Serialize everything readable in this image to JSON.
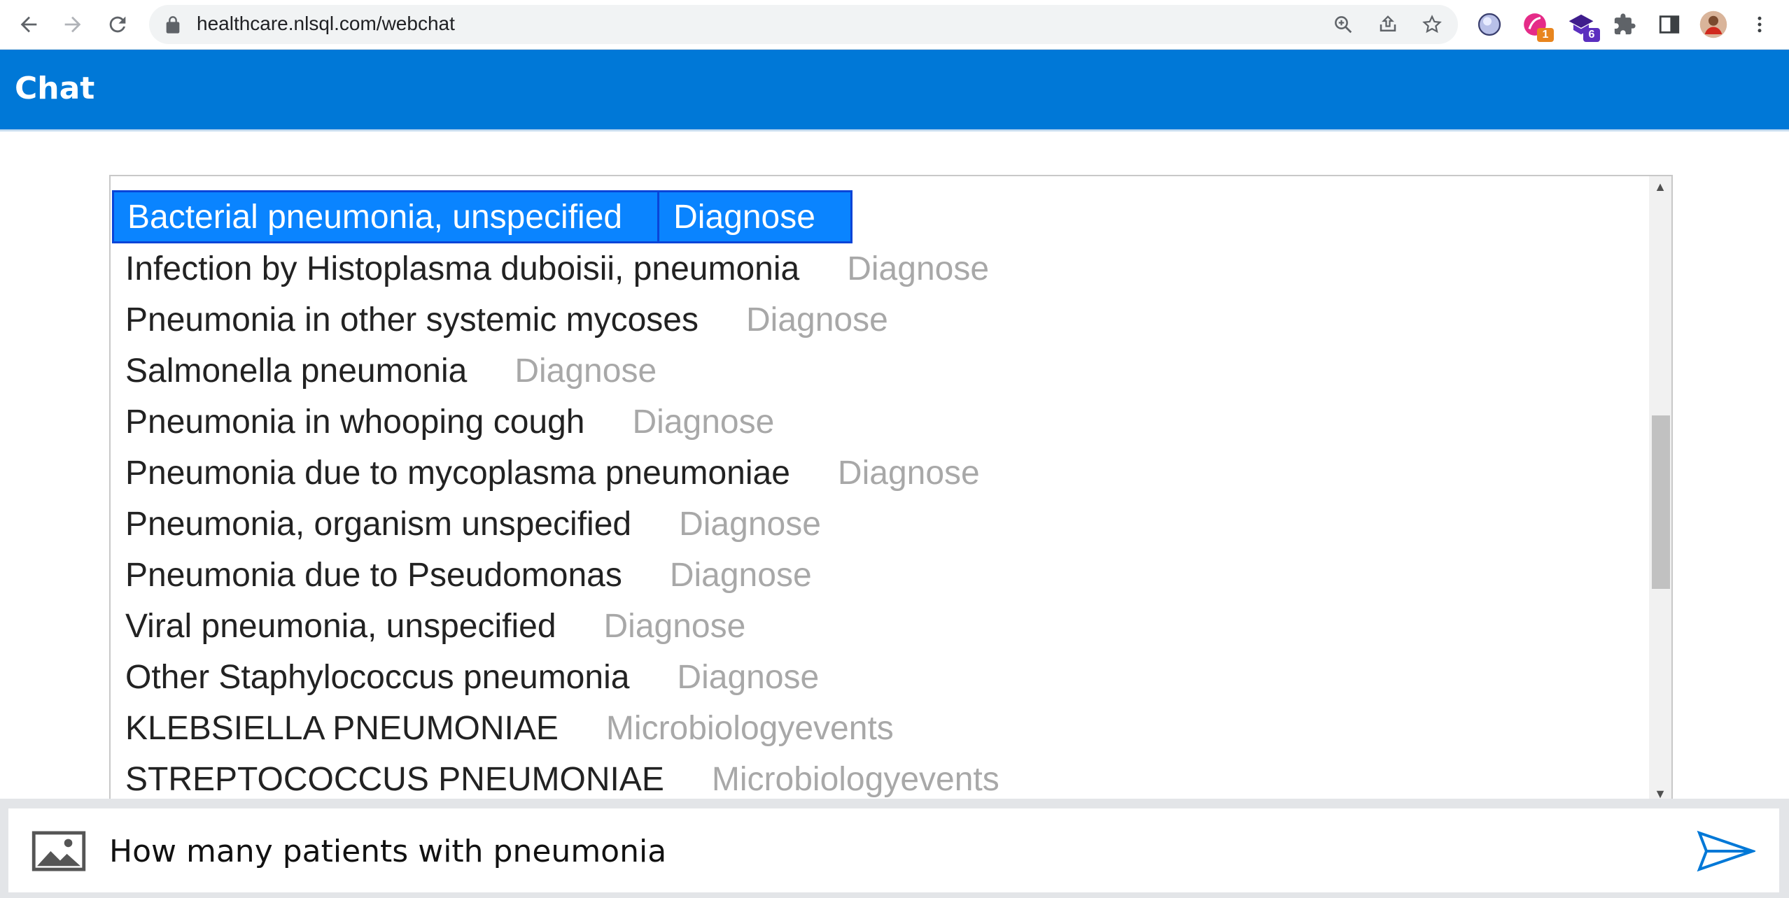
{
  "browser": {
    "url": "healthcare.nlsql.com/webchat",
    "extensions": [
      {
        "name": "circle-extension-icon",
        "badge": ""
      },
      {
        "name": "pen-extension-icon",
        "badge": "1"
      },
      {
        "name": "cap-extension-icon",
        "badge": "6"
      },
      {
        "name": "puzzle-icon",
        "badge": ""
      }
    ]
  },
  "header": {
    "title": "Chat"
  },
  "results": {
    "partial_row_name": "Ba...",
    "items": [
      {
        "name": "Bacterial pneumonia, unspecified",
        "action": "Diagnose",
        "selected": true
      },
      {
        "name": "Infection by Histoplasma duboisii, pneumonia",
        "action": "Diagnose",
        "selected": false
      },
      {
        "name": "Pneumonia in other systemic mycoses",
        "action": "Diagnose",
        "selected": false
      },
      {
        "name": "Salmonella pneumonia",
        "action": "Diagnose",
        "selected": false
      },
      {
        "name": "Pneumonia in whooping cough",
        "action": "Diagnose",
        "selected": false
      },
      {
        "name": "Pneumonia due to mycoplasma pneumoniae",
        "action": "Diagnose",
        "selected": false
      },
      {
        "name": "Pneumonia, organism unspecified",
        "action": "Diagnose",
        "selected": false
      },
      {
        "name": "Pneumonia due to Pseudomonas",
        "action": "Diagnose",
        "selected": false
      },
      {
        "name": "Viral pneumonia, unspecified",
        "action": "Diagnose",
        "selected": false
      },
      {
        "name": "Other Staphylococcus pneumonia",
        "action": "Diagnose",
        "selected": false
      },
      {
        "name": "KLEBSIELLA PNEUMONIAE",
        "action": "Microbiologyevents",
        "selected": false
      },
      {
        "name": "STREPTOCOCCUS PNEUMONIAE",
        "action": "Microbiologyevents",
        "selected": false
      }
    ]
  },
  "composer": {
    "value": "How many patients with pneumonia"
  },
  "colors": {
    "accent": "#0078d7",
    "selected": "#0a84ff",
    "muted": "#a8a8a8"
  }
}
